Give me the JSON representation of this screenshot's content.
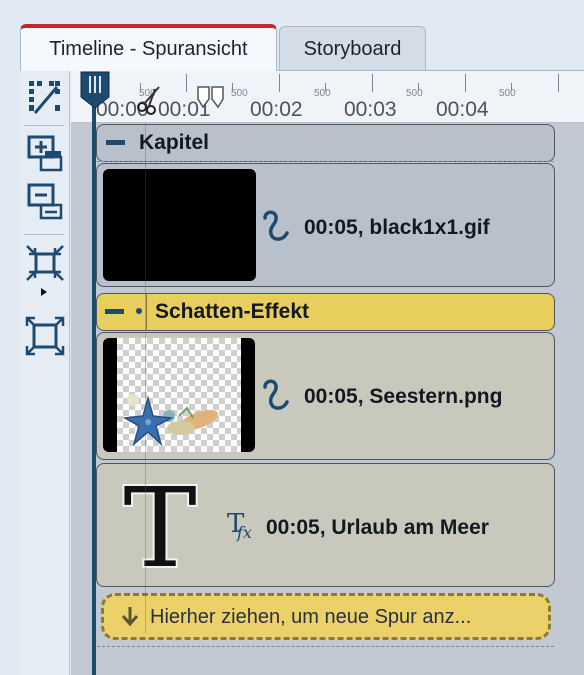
{
  "tabs": [
    {
      "label": "Timeline - Spuransicht",
      "active": true
    },
    {
      "label": "Storyboard",
      "active": false
    }
  ],
  "toolbar": {
    "items": [
      "cut-clip-icon",
      "add-track-icon",
      "remove-track-icon",
      "shrink-view-icon",
      "expand-view-icon"
    ]
  },
  "ruler": {
    "times": [
      "00:00",
      "00:01",
      "00:02",
      "00:03",
      "00:04"
    ],
    "half_labels": [
      "500",
      "500",
      "500",
      "500",
      "500"
    ]
  },
  "chapter": {
    "label": "Kapitel"
  },
  "effect_group": {
    "label": "Schatten-Effekt"
  },
  "clips": [
    {
      "duration": "00:05,",
      "name": "black1x1.gif",
      "icon": "curve-icon"
    },
    {
      "duration": "00:05,",
      "name": "Seestern.png",
      "icon": "curve-icon"
    },
    {
      "duration": "00:05,",
      "name": "Urlaub am Meer",
      "icon": "text-fx-icon"
    }
  ],
  "dropzone": {
    "label": "Hierher ziehen, um neue Spur anz..."
  },
  "colors": {
    "active_tab_accent": "#c8252e",
    "playhead": "#1e4a70",
    "effect_yellow": "#e8cf5d",
    "icon_blue": "#1e4a70"
  }
}
